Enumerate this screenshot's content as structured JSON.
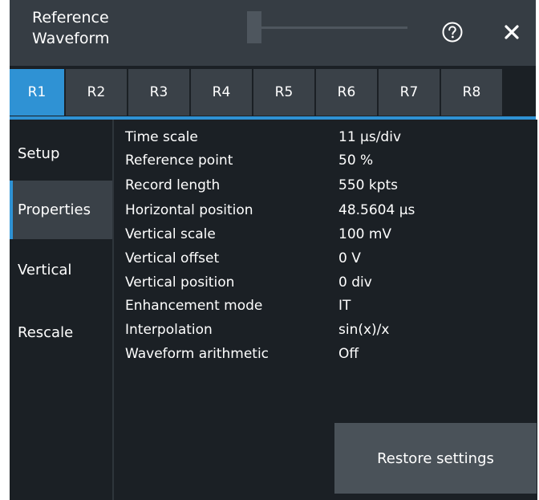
{
  "window": {
    "title_line1": "Reference",
    "title_line2": "Waveform",
    "help_icon": "question-circle-icon",
    "close_icon": "close-icon"
  },
  "tabs": [
    {
      "label": "R1",
      "active": true
    },
    {
      "label": "R2",
      "active": false
    },
    {
      "label": "R3",
      "active": false
    },
    {
      "label": "R4",
      "active": false
    },
    {
      "label": "R5",
      "active": false
    },
    {
      "label": "R6",
      "active": false
    },
    {
      "label": "R7",
      "active": false
    },
    {
      "label": "R8",
      "active": false
    }
  ],
  "sidebar": {
    "items": [
      {
        "label": "Setup",
        "active": false
      },
      {
        "label": "Properties",
        "active": true
      },
      {
        "label": "Vertical",
        "active": false
      },
      {
        "label": "Rescale",
        "active": false
      }
    ]
  },
  "properties": [
    {
      "label": "Time scale",
      "value": "11 µs/div"
    },
    {
      "label": "Reference point",
      "value": "50 %"
    },
    {
      "label": "Record length",
      "value": "550 kpts"
    },
    {
      "label": "Horizontal position",
      "value": "48.5604 µs"
    },
    {
      "label": "Vertical scale",
      "value": "100 mV"
    },
    {
      "label": "Vertical offset",
      "value": "0 V"
    },
    {
      "label": "Vertical position",
      "value": "0 div"
    },
    {
      "label": "Enhancement mode",
      "value": "IT"
    },
    {
      "label": "Interpolation",
      "value": "sin(x)/x"
    },
    {
      "label": "Waveform arithmetic",
      "value": "Off"
    }
  ],
  "actions": {
    "restore_label": "Restore settings"
  },
  "colors": {
    "accent": "#2f92d4",
    "background": "#1b2025",
    "titlebar": "#363d44",
    "tab": "#3a4148",
    "button": "#4a5259"
  }
}
